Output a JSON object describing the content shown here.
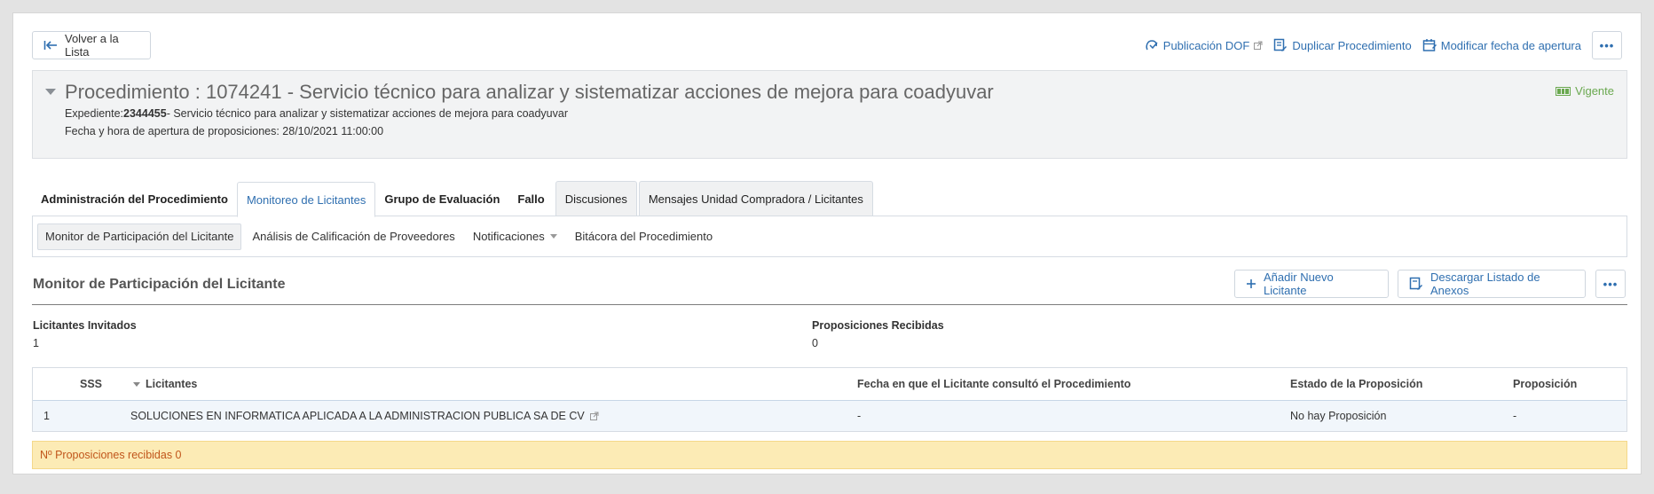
{
  "topbar": {
    "back_label": "Volver a la Lista",
    "actions": [
      {
        "label": "Publicación DOF",
        "icon": "publish-icon"
      },
      {
        "label": "Duplicar Procedimiento",
        "icon": "duplicate-icon"
      },
      {
        "label": "Modificar fecha de apertura",
        "icon": "calendar-edit-icon"
      }
    ],
    "more_label": "•••"
  },
  "procedure": {
    "title": "Procedimiento : 1074241 - Servicio técnico para analizar y sistematizar acciones de mejora para coadyuvar",
    "expediente_label": "Expediente:",
    "expediente_number": "2344455",
    "expediente_desc": "- Servicio técnico para analizar y sistematizar acciones de mejora para coadyuvar",
    "opening": "Fecha y hora de apertura de proposiciones: 28/10/2021 11:00:00",
    "status": "Vigente",
    "status_color": "#6aa84f"
  },
  "tabs": [
    {
      "label": "Administración del Procedimiento"
    },
    {
      "label": "Monitoreo de Licitantes"
    },
    {
      "label": "Grupo de Evaluación"
    },
    {
      "label": "Fallo"
    },
    {
      "label": "Discusiones"
    },
    {
      "label": "Mensajes Unidad Compradora / Licitantes"
    }
  ],
  "subtabs": [
    {
      "label": "Monitor de Participación del Licitante"
    },
    {
      "label": "Análisis de Calificación de Proveedores"
    },
    {
      "label": "Notificaciones"
    },
    {
      "label": "Bitácora del Procedimiento"
    }
  ],
  "section": {
    "title": "Monitor de Participación del Licitante",
    "add_label": "Añadir Nuevo Licitante",
    "download_label": "Descargar Listado de Anexos",
    "more_label": "•••"
  },
  "stats": {
    "invited_label": "Licitantes Invitados",
    "invited_value": "1",
    "received_label": "Proposiciones Recibidas",
    "received_value": "0"
  },
  "table": {
    "columns": [
      "SSS",
      "Licitantes",
      "Fecha en que el Licitante consultó el Procedimiento",
      "Estado de la Proposición",
      "Proposición"
    ],
    "rows": [
      [
        "1",
        "SOLUCIONES EN INFORMATICA APLICADA A LA ADMINISTRACION PUBLICA SA DE CV",
        "-",
        "No hay Proposición",
        "-"
      ]
    ]
  },
  "warning": "Nº Proposiciones recibidas 0",
  "colors": {
    "accent": "#2f6fb0",
    "warning_bg": "#fcebb5",
    "warning_text": "#c1561b"
  }
}
